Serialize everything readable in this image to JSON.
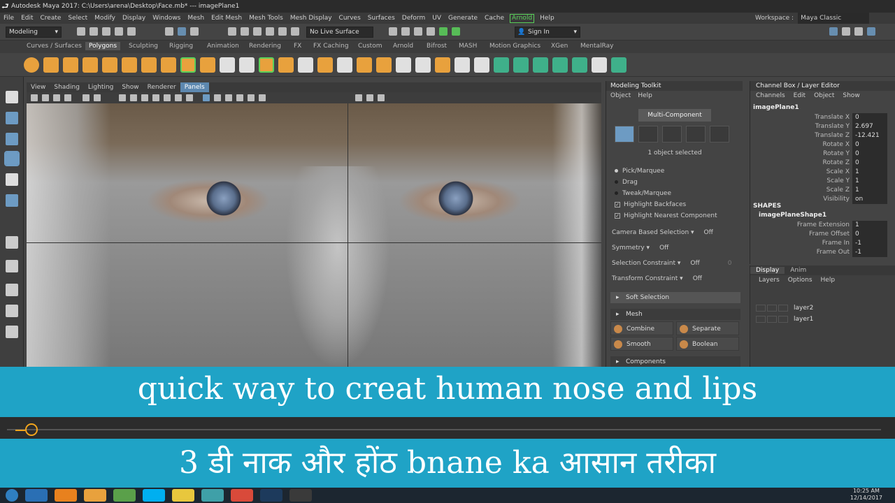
{
  "window": {
    "title": "Autodesk Maya 2017: C:\\Users\\arena\\Desktop\\Face.mb*  ---  imagePlane1"
  },
  "menubar": {
    "items": [
      "File",
      "Edit",
      "Create",
      "Select",
      "Modify",
      "Display",
      "Windows",
      "Mesh",
      "Edit Mesh",
      "Mesh Tools",
      "Mesh Display",
      "Curves",
      "Surfaces",
      "Deform",
      "UV",
      "Generate",
      "Cache"
    ],
    "arnold": "Arnold",
    "help": "Help",
    "workspace_label": "Workspace :",
    "workspace_value": "Maya Classic"
  },
  "statusline": {
    "mode": "Modeling",
    "live_surface": "No Live Surface",
    "sign_in": "Sign In"
  },
  "shelf_tabs": [
    "Curves / Surfaces",
    "Polygons",
    "Sculpting",
    "Rigging",
    "Animation",
    "Rendering",
    "FX",
    "FX Caching",
    "Custom",
    "Arnold",
    "Bifrost",
    "MASH",
    "Motion Graphics",
    "XGen",
    "MentalRay"
  ],
  "viewport_menu": [
    "View",
    "Shading",
    "Lighting",
    "Show",
    "Renderer",
    "Panels"
  ],
  "modeling_toolkit": {
    "title": "Modeling Toolkit",
    "menu": [
      "Object",
      "Help"
    ],
    "multi_component": "Multi-Component",
    "objects_selected": "1 object selected",
    "pick_marquee": "Pick/Marquee",
    "drag": "Drag",
    "tweak_marquee": "Tweak/Marquee",
    "highlight_backfaces": "Highlight Backfaces",
    "highlight_nearest": "Highlight Nearest Component",
    "camera_selection": "Camera Based Selection",
    "camera_selection_val": "Off",
    "symmetry": "Symmetry",
    "symmetry_val": "Off",
    "selection_constraint": "Selection Constraint",
    "selection_constraint_val": "Off",
    "selection_constraint_num": "0",
    "transform_constraint": "Transform Constraint",
    "transform_constraint_val": "Off",
    "soft_selection": "Soft Selection",
    "mesh_section": "Mesh",
    "combine": "Combine",
    "separate": "Separate",
    "smooth": "Smooth",
    "boolean": "Boolean",
    "components_section": "Components"
  },
  "channel_box": {
    "title": "Channel Box / Layer Editor",
    "menu": [
      "Channels",
      "Edit",
      "Object",
      "Show"
    ],
    "object": "imagePlane1",
    "attributes": [
      {
        "name": "Translate X",
        "value": "0"
      },
      {
        "name": "Translate Y",
        "value": "2.697"
      },
      {
        "name": "Translate Z",
        "value": "-12.421"
      },
      {
        "name": "Rotate X",
        "value": "0"
      },
      {
        "name": "Rotate Y",
        "value": "0"
      },
      {
        "name": "Rotate Z",
        "value": "0"
      },
      {
        "name": "Scale X",
        "value": "1"
      },
      {
        "name": "Scale Y",
        "value": "1"
      },
      {
        "name": "Scale Z",
        "value": "1"
      },
      {
        "name": "Visibility",
        "value": "on"
      }
    ],
    "shapes_label": "SHAPES",
    "shape_name": "imagePlaneShape1",
    "shape_attributes": [
      {
        "name": "Frame Extension",
        "value": "1"
      },
      {
        "name": "Frame Offset",
        "value": "0"
      },
      {
        "name": "Frame In",
        "value": "-1"
      },
      {
        "name": "Frame Out",
        "value": "-1"
      }
    ]
  },
  "layer_editor": {
    "tabs": [
      "Display",
      "Anim"
    ],
    "menu": [
      "Layers",
      "Options",
      "Help"
    ],
    "layers": [
      "layer2",
      "layer1"
    ]
  },
  "banner": {
    "english": "quick way to creat human nose and lips",
    "hindi": "3 डी नाक और होंठ bnane ka आसान तरीका"
  },
  "taskbar": {
    "time": "10:25 AM",
    "date": "12/14/2017"
  },
  "colors": {
    "banner": "#1fa3c6",
    "playhead": "#f2a51d",
    "selected_tool": "#6d9bc3"
  }
}
